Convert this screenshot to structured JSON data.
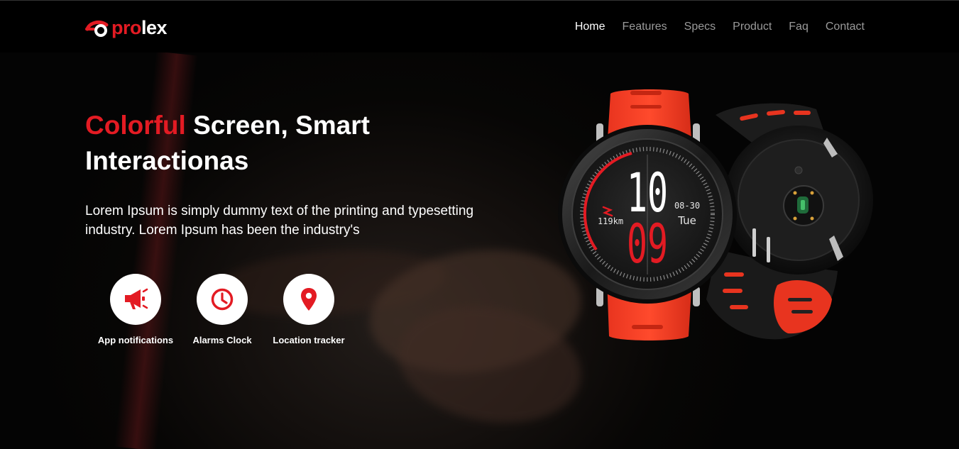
{
  "brand": {
    "name_part1": "pro",
    "name_part2": "lex",
    "accent_color": "#e31b23"
  },
  "nav": {
    "items": [
      {
        "label": "Home",
        "active": true
      },
      {
        "label": "Features",
        "active": false
      },
      {
        "label": "Specs",
        "active": false
      },
      {
        "label": "Product",
        "active": false
      },
      {
        "label": "Faq",
        "active": false
      },
      {
        "label": "Contact",
        "active": false
      }
    ]
  },
  "hero": {
    "title_accent": "Colorful",
    "title_rest": " Screen, Smart Interactionas",
    "description": "Lorem Ipsum is simply dummy text of the printing and typesetting industry. Lorem Ipsum has been the industry's"
  },
  "features": [
    {
      "icon": "megaphone-icon",
      "label": "App notifications"
    },
    {
      "icon": "clock-icon",
      "label": "Alarms Clock"
    },
    {
      "icon": "location-pin-icon",
      "label": "Location tracker"
    }
  ],
  "watch_face": {
    "hour": "10",
    "minute": "09",
    "date": "08-30",
    "weekday": "Tue",
    "distance": "119km"
  }
}
